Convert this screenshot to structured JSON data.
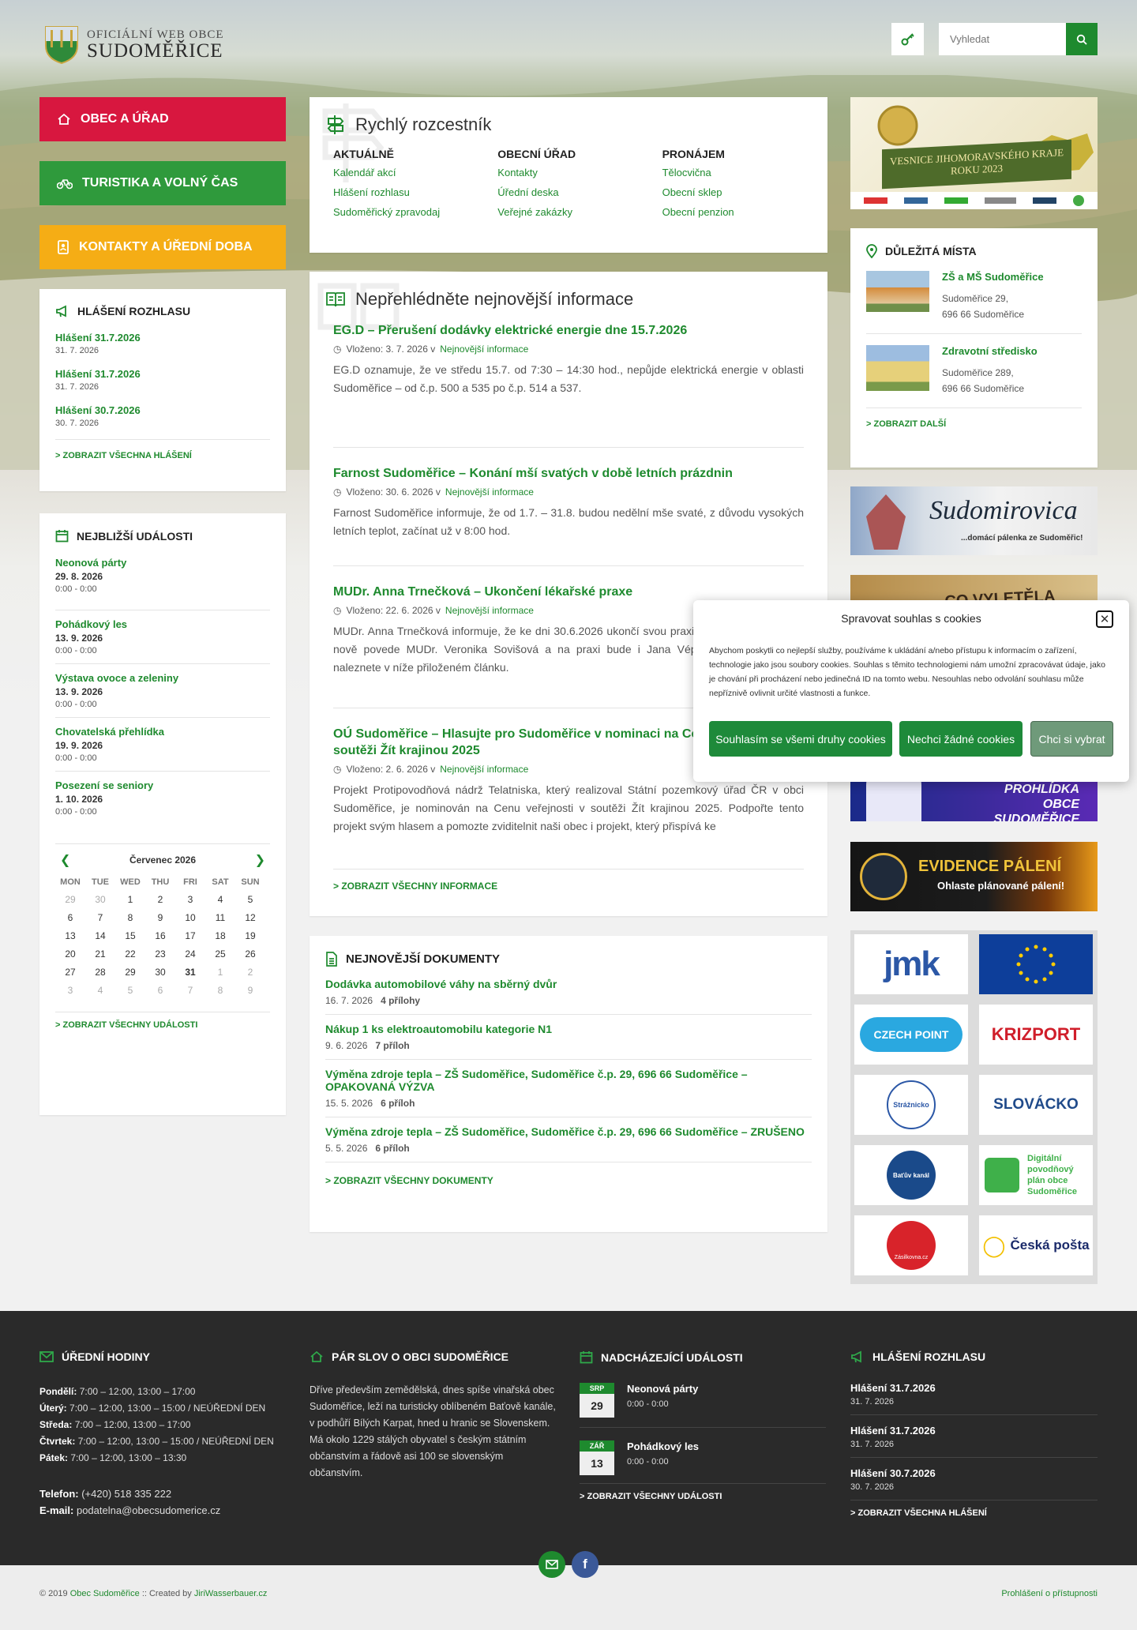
{
  "header": {
    "logo_line1": "Oficiální web obce",
    "logo_line2": "Sudoměřice",
    "search_placeholder": "Vyhledat"
  },
  "nav": [
    {
      "label": "Obec a úřad",
      "color": "#d8173f"
    },
    {
      "label": "Turistika a volný čas",
      "color": "#2f9a3c"
    },
    {
      "label": "Kontakty a úřední doba",
      "color": "#f5ad15"
    }
  ],
  "broadcast": {
    "title": "Hlášení rozhlasu",
    "items": [
      {
        "title": "Hlášení 31.7.2026",
        "date": "31. 7. 2026"
      },
      {
        "title": "Hlášení 31.7.2026",
        "date": "31. 7. 2026"
      },
      {
        "title": "Hlášení 30.7.2026",
        "date": "30. 7. 2026"
      }
    ],
    "more": "> Zobrazit všechna hlášení"
  },
  "events": {
    "title": "Nejbližší události",
    "items": [
      {
        "title": "Neonová párty",
        "date": "29. 8. 2026",
        "time": "0:00 - 0:00"
      },
      {
        "title": "Pohádkový les",
        "date": "13. 9. 2026",
        "time": "0:00 - 0:00"
      },
      {
        "title": "Výstava ovoce a zeleniny",
        "date": "13. 9. 2026",
        "time": "0:00 - 0:00"
      },
      {
        "title": "Chovatelská přehlídka",
        "date": "19. 9. 2026",
        "time": "0:00 - 0:00"
      },
      {
        "title": "Posezení se seniory",
        "date": "1. 10. 2026",
        "time": "0:00 - 0:00"
      }
    ],
    "more": "> Zobrazit všechny události"
  },
  "calendar": {
    "month": "Červenec 2026",
    "days": [
      "MON",
      "TUE",
      "WED",
      "THU",
      "FRI",
      "SAT",
      "SUN"
    ],
    "cells": [
      "29",
      "30",
      "1",
      "2",
      "3",
      "4",
      "5",
      "6",
      "7",
      "8",
      "9",
      "10",
      "11",
      "12",
      "13",
      "14",
      "15",
      "16",
      "17",
      "18",
      "19",
      "20",
      "21",
      "22",
      "23",
      "24",
      "25",
      "26",
      "27",
      "28",
      "29",
      "30",
      "31",
      "1",
      "2",
      "3",
      "4",
      "5",
      "6",
      "7",
      "8",
      "9"
    ]
  },
  "quicklinks": {
    "title": "Rychlý rozcestník",
    "cols": [
      {
        "head": "Aktuálně",
        "links": [
          "Kalendář akcí",
          "Hlášení rozhlasu",
          "Sudoměřický zpravodaj"
        ]
      },
      {
        "head": "Obecní úřad",
        "links": [
          "Kontakty",
          "Úřední deska",
          "Veřejné zakázky"
        ]
      },
      {
        "head": "Pronájem",
        "links": [
          "Tělocvična",
          "Obecní sklep",
          "Obecní penzion"
        ]
      }
    ]
  },
  "news": {
    "title": "Nepřehlédněte nejnovější informace",
    "items": [
      {
        "title": "EG.D – Přerušení dodávky elektrické energie dne 15.7.2026",
        "meta_prefix": "Vloženo: 3. 7. 2026 v",
        "category": "Nejnovější informace",
        "excerpt": "EG.D oznamuje, že ve středu 15.7. od 7:30 – 14:30 hod., nepůjde elektrická energie v oblasti Sudoměřice – od č.p. 500 a 535 po č.p. 514 a 537."
      },
      {
        "title": "Farnost Sudoměřice – Konání mší svatých v době letních prázdnin",
        "meta_prefix": "Vloženo: 30. 6. 2026 v",
        "category": "Nejnovější informace",
        "excerpt": "Farnost Sudoměřice informuje, že od 1.7. – 31.8. budou nedělní mše svaté, z důvodu vysokých letních teplot, začínat už v 8:00 hod."
      },
      {
        "title": "MUDr. Anna Trnečková – Ukončení lékařské praxe",
        "meta_prefix": "Vloženo: 22. 6. 2026 v",
        "category": "Nejnovější informace",
        "excerpt": "MUDr. Anna Trnečková informuje, že ke dni 30.6.2026 ukončí svou praxi. Ordinaci ve Strážnici nově povede MUDr. Veronika Sovišová a na praxi bude i Jana Vépyová. Více informací naleznete v níže přiloženém článku."
      },
      {
        "title": "OÚ Sudoměřice – Hlasujte pro Sudoměřice v nominaci na Cenu veřejnosti v soutěži Žít krajinou 2025",
        "meta_prefix": "Vloženo: 2. 6. 2026 v",
        "category": "Nejnovější informace",
        "excerpt": "Projekt Protipovodňová nádrž Telatniska, který realizoval Státní pozemkový úřad ČR v obci Sudoměřice, je nominován na Cenu veřejnosti v soutěži Žít krajinou 2025. Podpořte tento projekt svým hlasem a pomozte zviditelnit naši obec i projekt, který přispívá ke"
      }
    ],
    "more": "> Zobrazit všechny informace"
  },
  "documents": {
    "title": "Nejnovější dokumenty",
    "items": [
      {
        "title": "Dodávka automobilové váhy na sběrný dvůr",
        "date": "16. 7. 2026",
        "attach": "4 přílohy"
      },
      {
        "title": "Nákup 1 ks elektroautomobilu kategorie N1",
        "date": "9. 6. 2026",
        "attach": "7 příloh"
      },
      {
        "title": "Výměna zdroje tepla – ZŠ Sudoměřice, Sudoměřice č.p. 29, 696 66 Sudoměřice – OPAKOVANÁ VÝZVA",
        "date": "15. 5. 2026",
        "attach": "6 příloh"
      },
      {
        "title": "Výměna zdroje tepla – ZŠ Sudoměřice, Sudoměřice č.p. 29, 696 66 Sudoměřice – ZRUŠENO",
        "date": "5. 5. 2026",
        "attach": "6 příloh"
      }
    ],
    "more": "> Zobrazit všechny dokumenty"
  },
  "banners": {
    "vesnice_line1": "VESNICE JIHOMORAVSKÉHO KRAJE",
    "vesnice_line2": "ROKU 2023",
    "sudomirovica": "Sudomirovica",
    "sudomirovica_sub": "...domácí pálenka ze Sudoměřic!",
    "holubicka": "CO VYLETĚLA HOLUBIČKA",
    "prohlidka_1": "PROHLÍDKA",
    "prohlidka_2": "OBCE SUDOMĚŘICE",
    "evidence_1": "EVIDENCE PÁLENÍ",
    "evidence_2": "Ohlaste plánované pálení!"
  },
  "places": {
    "title": "Důležitá místa",
    "items": [
      {
        "name": "ZŠ a MŠ Sudoměřice",
        "addr1": "Sudoměřice 29,",
        "addr2": "696 66 Sudoměřice"
      },
      {
        "name": "Zdravotní středisko",
        "addr1": "Sudoměřice 289,",
        "addr2": "696 66 Sudoměřice"
      }
    ],
    "more": "> Zobrazit další"
  },
  "logos": [
    "jmk",
    "EU",
    "CZECH POINT",
    "KRIZPORT",
    "Strážnicko",
    "SLOVÁCKO",
    "Baťův kanál",
    "Digitální povodňový plán obce Sudoměřice",
    "Zásilkovna.cz",
    "Česká pošta"
  ],
  "cookie": {
    "title": "Spravovat souhlas s cookies",
    "text": "Abychom poskytli co nejlepší služby, používáme k ukládání a/nebo přístupu k informacím o zařízení, technologie jako jsou soubory cookies. Souhlas s těmito technologiemi nám umožní zpracovávat údaje, jako je chování při procházení nebo jedinečná ID na tomto webu. Nesouhlas nebo odvolání souhlasu může nepříznivě ovlivnit určité vlastnosti a funkce.",
    "accept": "Souhlasím se všemi druhy cookies",
    "deny": "Nechci žádné cookies",
    "choose": "Chci si vybrat"
  },
  "footer": {
    "hours": {
      "title": "Úřední hodiny",
      "rows": [
        {
          "day": "Pondělí:",
          "time": "7:00 – 12:00, 13:00 – 17:00"
        },
        {
          "day": "Úterý:",
          "time": "7:00 – 12:00, 13:00 – 15:00 / NEÚŘEDNÍ DEN"
        },
        {
          "day": "Středa:",
          "time": "7:00 – 12:00, 13:00 – 17:00"
        },
        {
          "day": "Čtvrtek:",
          "time": "7:00 – 12:00, 13:00 – 15:00 / NEÚŘEDNÍ DEN"
        },
        {
          "day": "Pátek:",
          "time": "7:00 – 12:00, 13:00 – 13:30"
        }
      ],
      "phone_label": "Telefon:",
      "phone": "(+420) 518 335 222",
      "email_label": "E-mail:",
      "email": "podatelna@obecsudomerice.cz"
    },
    "about": {
      "title": "Pár slov o obci Sudoměřice",
      "text": "Dříve především zemědělská, dnes spíše vinařská obec Sudoměřice, leží na turisticky oblíbeném Baťově kanále, v podhůří Bílých Karpat, hned u hranic se Slovenskem. Má okolo 1229 stálých obyvatel s českým státním občanstvím a řádově asi 100 se slovenským občanstvím."
    },
    "events": {
      "title": "Nadcházející události",
      "items": [
        {
          "month": "SRP",
          "day": "29",
          "title": "Neonová párty",
          "time": "0:00 - 0:00"
        },
        {
          "month": "ZÁŘ",
          "day": "13",
          "title": "Pohádkový les",
          "time": "0:00 - 0:00"
        }
      ],
      "more": "> Zobrazit všechny události"
    },
    "broadcast": {
      "title": "Hlášení rozhlasu",
      "items": [
        {
          "title": "Hlášení 31.7.2026",
          "date": "31. 7. 2026"
        },
        {
          "title": "Hlášení 31.7.2026",
          "date": "31. 7. 2026"
        },
        {
          "title": "Hlášení 30.7.2026",
          "date": "30. 7. 2026"
        }
      ],
      "more": "> Zobrazit všechna hlášení"
    }
  },
  "bottom": {
    "copy": "© 2019",
    "org": "Obec Sudoměřice",
    "created": ":: Created by",
    "author": "JiriWasserbauer.cz",
    "access": "Prohlášení o přístupnosti"
  },
  "colors": {
    "green": "#1e8a2e",
    "red": "#d8173f",
    "orange": "#f5ad15",
    "dark": "#2a2a2a"
  }
}
